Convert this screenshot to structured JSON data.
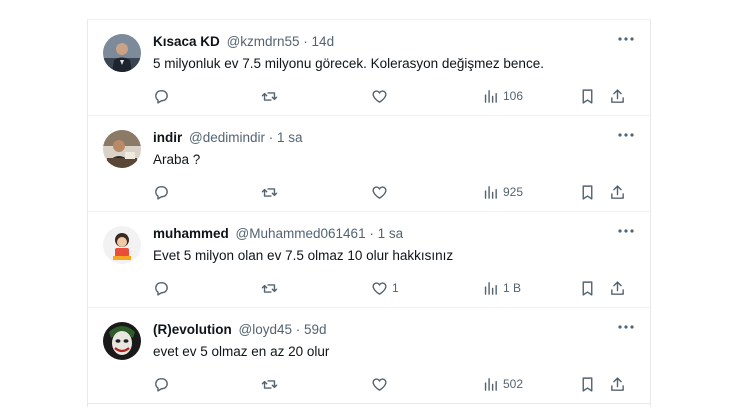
{
  "tweets": [
    {
      "name": "Kısaca KD",
      "handle": "@kzmdrn55",
      "time": "14d",
      "text": "5 milyonluk ev 7.5 milyonu görecek. Kolerasyon değişmez bence.",
      "likes": "",
      "views": "106",
      "avatar": "man-in-suit"
    },
    {
      "name": "indir",
      "handle": "@dedimindir",
      "time": "1 sa",
      "text": "Araba ?",
      "likes": "",
      "views": "925",
      "avatar": "man-at-desk"
    },
    {
      "name": "muhammed",
      "handle": "@Muhammed061461",
      "time": "1 sa",
      "text": "Evet 5 milyon olan ev 7.5 olmaz 10 olur hakkısınız",
      "likes": "1",
      "views": "1 B",
      "avatar": "cartoon-figure"
    },
    {
      "name": "(R)evolution",
      "handle": "@loyd45",
      "time": "59d",
      "text": "evet ev 5 olmaz en az 20 olur",
      "likes": "",
      "views": "502",
      "avatar": "joker-face"
    }
  ],
  "colors": {
    "text": "#0f1419",
    "secondary": "#536471",
    "border": "#eff3f4"
  }
}
